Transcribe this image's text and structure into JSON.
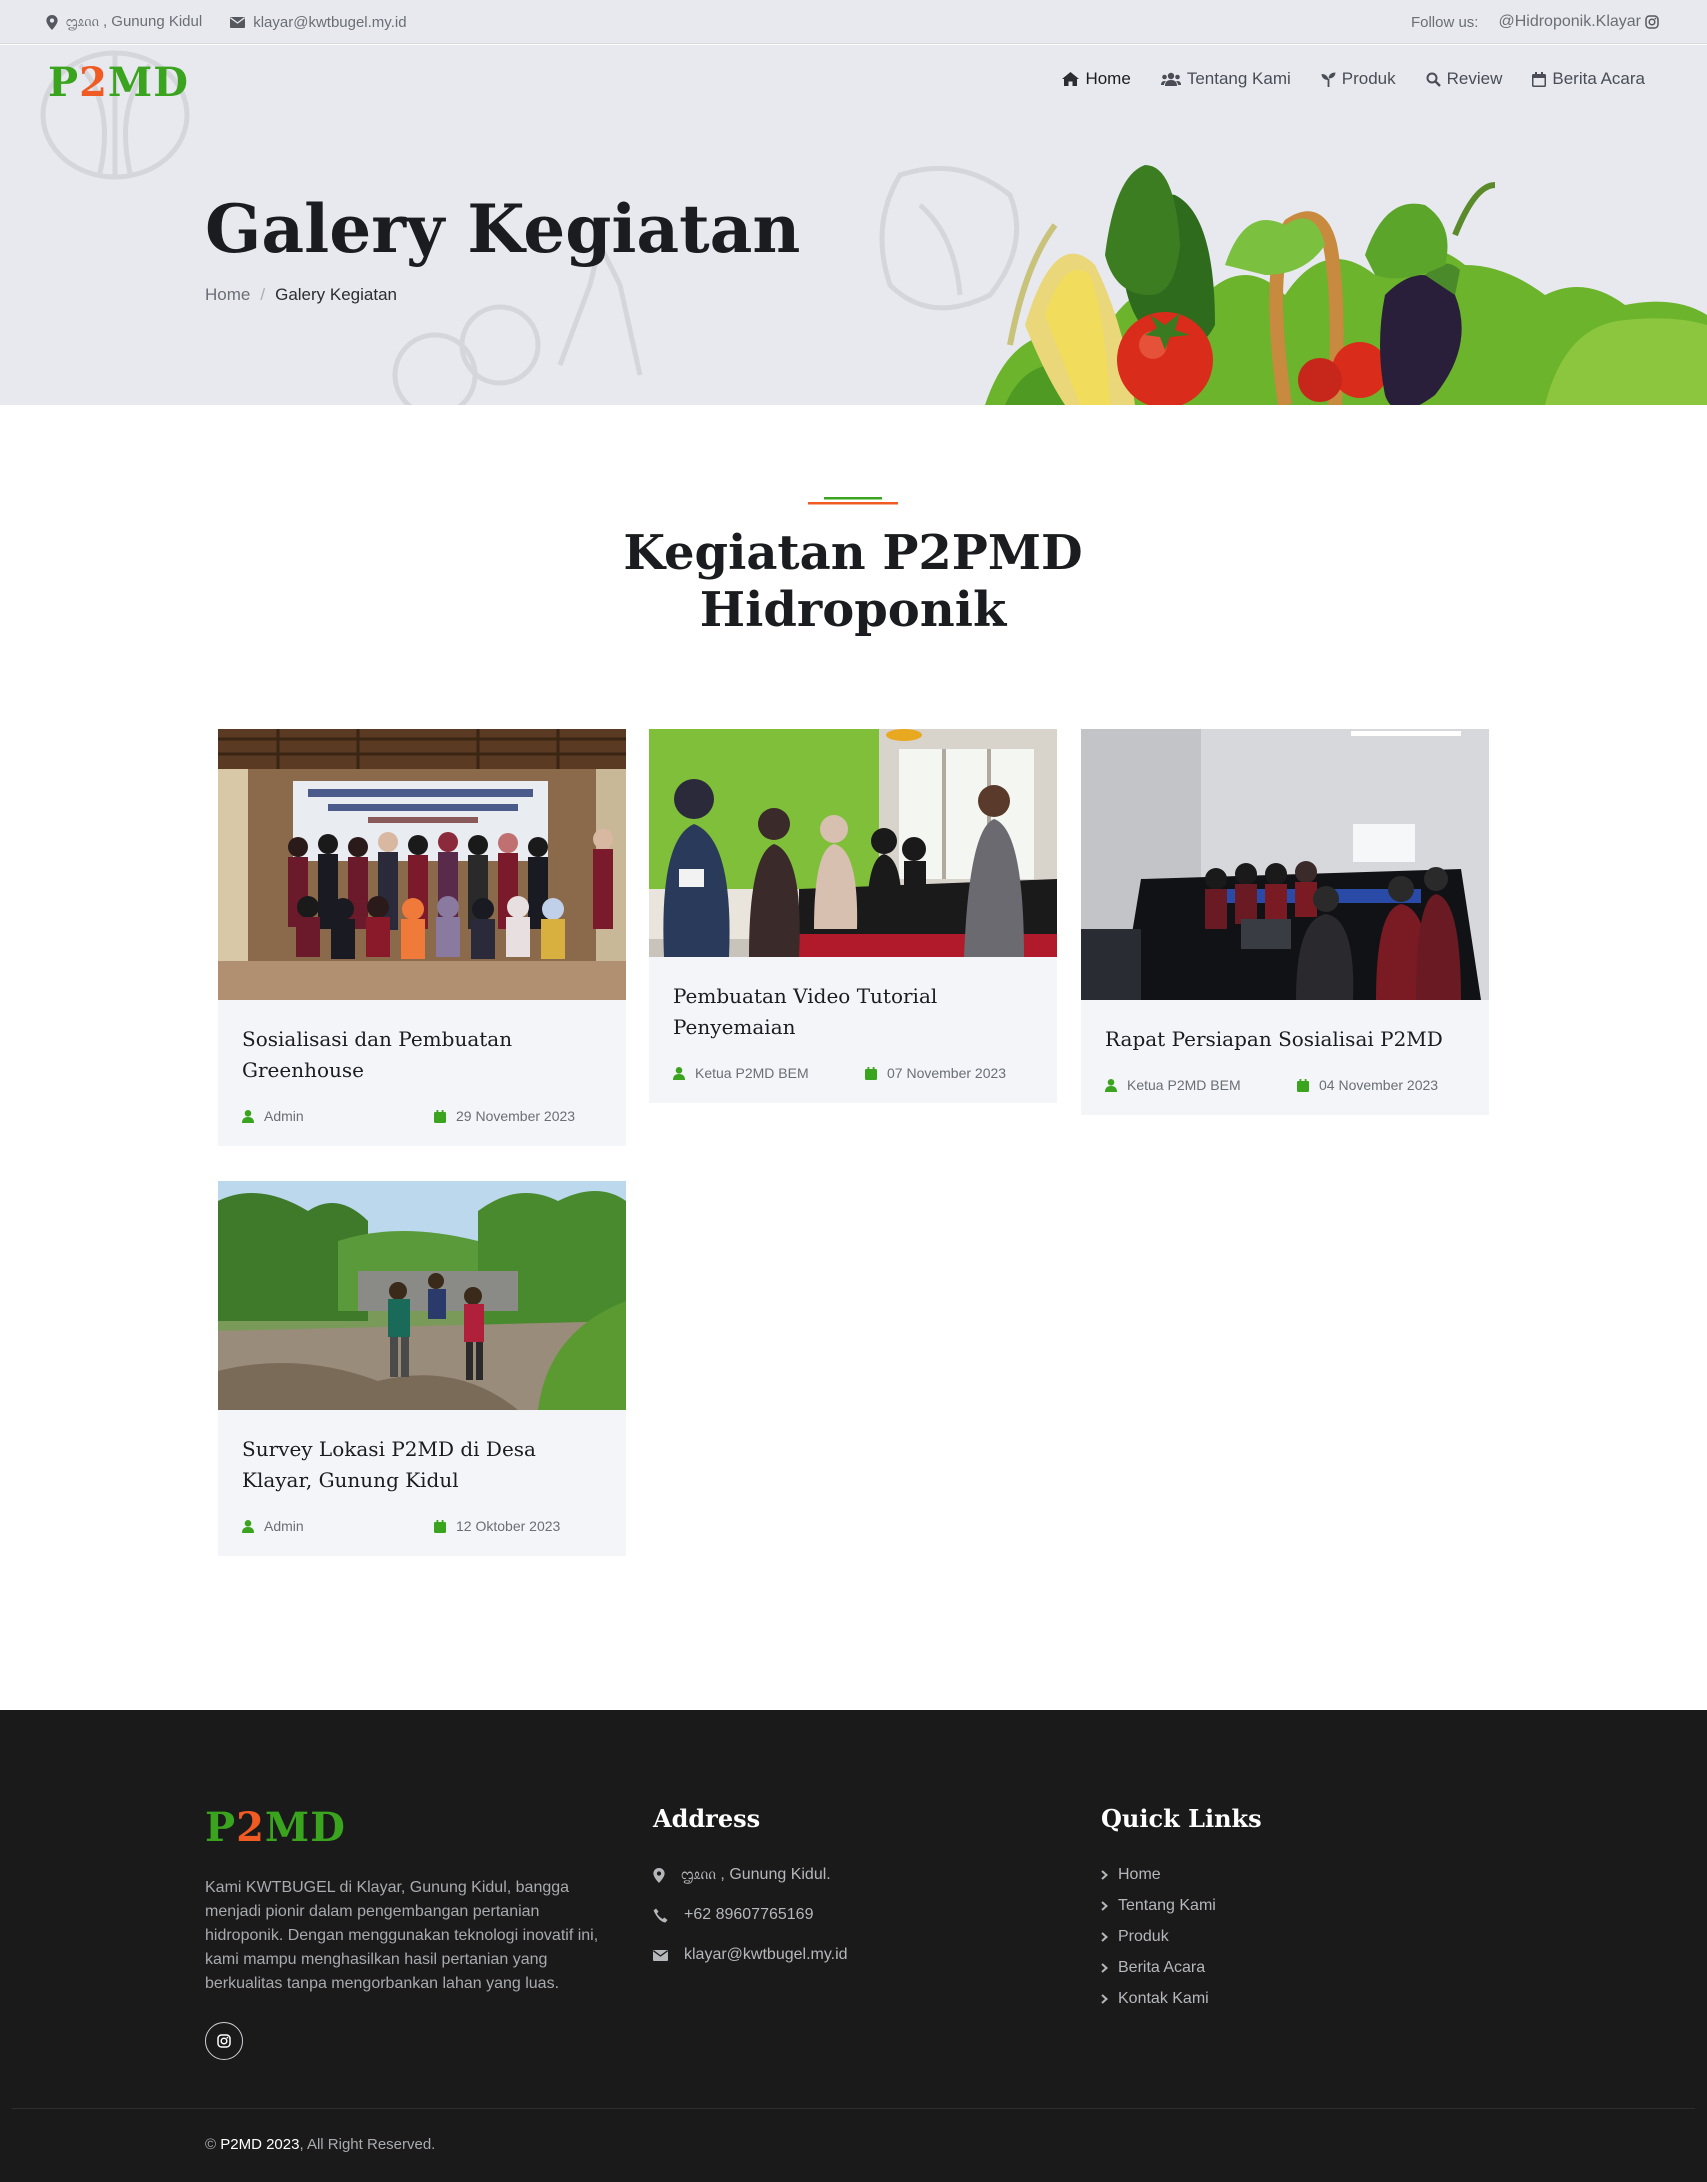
{
  "topbar": {
    "location": "ᦗᦸᦶ , Gunung Kidul",
    "email": "klayar@kwtbugel.my.id",
    "follow_label": "Follow us:",
    "follow_handle": "@Hidroponik.Klayar"
  },
  "header": {
    "logo_p": "P",
    "logo_2": "2",
    "logo_md": "MD",
    "nav": [
      {
        "label": "Home",
        "icon": "home-icon"
      },
      {
        "label": "Tentang Kami",
        "icon": "users-icon"
      },
      {
        "label": "Produk",
        "icon": "seedling-icon"
      },
      {
        "label": "Review",
        "icon": "search-icon"
      },
      {
        "label": "Berita Acara",
        "icon": "calendar-icon"
      }
    ]
  },
  "hero": {
    "title": "Galery Kegiatan",
    "breadcrumb_home": "Home",
    "breadcrumb_sep": "/",
    "breadcrumb_current": "Galery Kegiatan"
  },
  "section": {
    "title_line1": "Kegiatan P2PMD",
    "title_line2": "Hidroponik",
    "accent_green": "#3aa41f",
    "accent_orange": "#f05a23"
  },
  "cards": [
    {
      "title": "Sosialisasi dan Pembuatan Greenhouse",
      "author": "Admin",
      "date": "29 November 2023"
    },
    {
      "title": "Pembuatan Video Tutorial Penyemaian",
      "author": "Ketua P2MD BEM",
      "date": "07 November 2023"
    },
    {
      "title": "Rapat Persiapan Sosialisai P2MD",
      "author": "Ketua P2MD BEM",
      "date": "04 November 2023"
    },
    {
      "title": "Survey Lokasi P2MD di Desa Klayar, Gunung Kidul",
      "author": "Admin",
      "date": "12 Oktober 2023"
    }
  ],
  "footer": {
    "description": "Kami KWTBUGEL di Klayar, Gunung Kidul, bangga menjadi pionir dalam pengembangan pertanian hidroponik. Dengan menggunakan teknologi inovatif ini, kami mampu menghasilkan hasil pertanian yang berkualitas tanpa mengorbankan lahan yang luas.",
    "address_heading": "Address",
    "address": "ᦗᦸᦶ , Gunung Kidul.",
    "phone": "+62 89607765169",
    "email": "klayar@kwtbugel.my.id",
    "links_heading": "Quick Links",
    "links": [
      "Home",
      "Tentang Kami",
      "Produk",
      "Berita Acara",
      "Kontak Kami"
    ],
    "copyright_prefix": "©",
    "copyright_brand": "P2MD 2023",
    "copyright_suffix": ", All Right Reserved."
  }
}
